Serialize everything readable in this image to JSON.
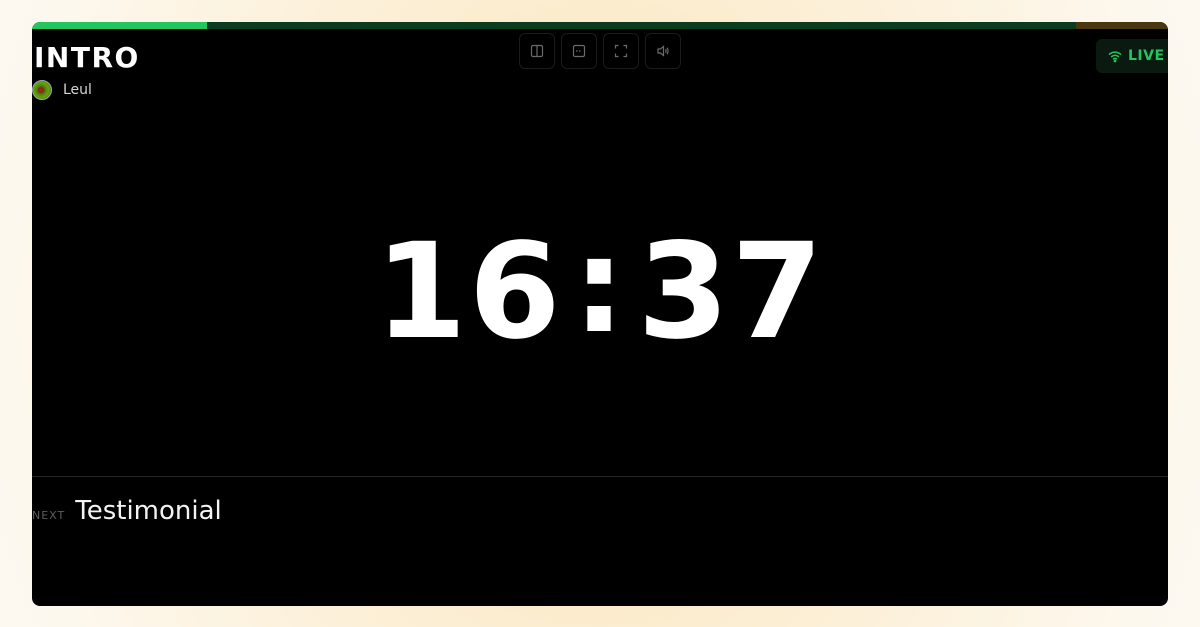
{
  "segment": {
    "title": "INTRO",
    "presenter": "Leul"
  },
  "progress": {
    "elapsed_fraction": 0.154,
    "overtime_fraction": 0.081,
    "colors": {
      "elapsed": "#22c55e",
      "remaining": "#0a3d20",
      "overtime": "#4a3710"
    }
  },
  "controls": [
    {
      "icon": "split-vertical-icon",
      "label": ""
    },
    {
      "icon": "split-horizontal-icon",
      "label": ""
    },
    {
      "icon": "fullscreen-icon",
      "label": ""
    },
    {
      "icon": "speaker-icon",
      "label": ""
    }
  ],
  "status": {
    "label": "LIVE",
    "icon": "wifi-icon",
    "color": "#22c55e"
  },
  "timer": {
    "minutes": "16",
    "separator": ":",
    "seconds": "37"
  },
  "next": {
    "label": "NEXT",
    "title": "Testimonial"
  }
}
